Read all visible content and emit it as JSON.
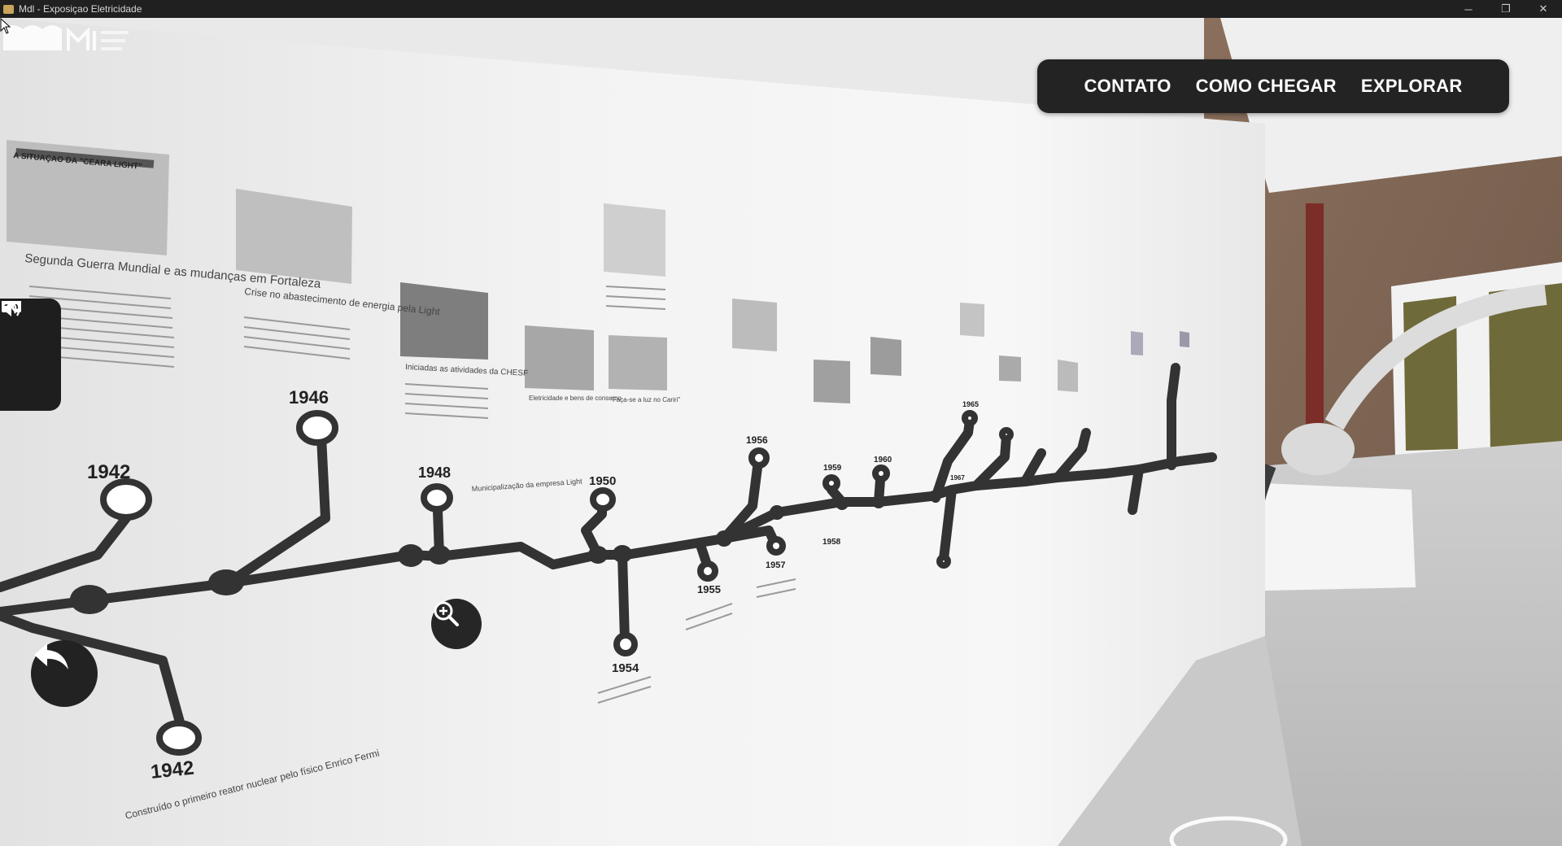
{
  "window": {
    "title": "Mdl - Exposiçao Eletricidade",
    "controls": {
      "minimize": "─",
      "maximize": "❐",
      "close": "✕"
    }
  },
  "nav": {
    "items": [
      {
        "label": "CONTATO"
      },
      {
        "label": "COMO CHEGAR"
      },
      {
        "label": "EXPLORAR"
      }
    ]
  },
  "side_buttons": [
    {
      "icon": "vr-headset-icon"
    },
    {
      "icon": "volume-icon"
    }
  ],
  "floating_buttons": {
    "zoom": {
      "icon": "zoom-in-icon"
    },
    "back": {
      "icon": "back-arrow-icon"
    }
  },
  "wall": {
    "headline_1": "A SITUAÇAO DA \"CEARA LIGHT\"",
    "caption_1942_title": "Segunda Guerra Mundial e as mudanças em Fortaleza",
    "caption_1946_title": "Crise no abastecimento de energia pela Light",
    "caption_1948_title": "Iniciadas as atividades da CHESF",
    "caption_1950_title": "Municipalização da empresa Light",
    "caption_light_title": "Eletricidade e bens de consumo",
    "caption_faca_title": "\"Faça-se a luz no Cariri\"",
    "caption_bottom_1942": "Construído o primeiro reator nuclear pelo físico Enrico Fermi",
    "years": {
      "y1942a": "1942",
      "y1946": "1946",
      "y1948": "1948",
      "y1950": "1950",
      "y1954": "1954",
      "y1955": "1955",
      "y1956": "1956",
      "y1957": "1957",
      "y1958": "1958",
      "y1959": "1959",
      "y1960": "1960",
      "y1965": "1965",
      "y1967": "1967",
      "y1942b": "1942"
    }
  }
}
